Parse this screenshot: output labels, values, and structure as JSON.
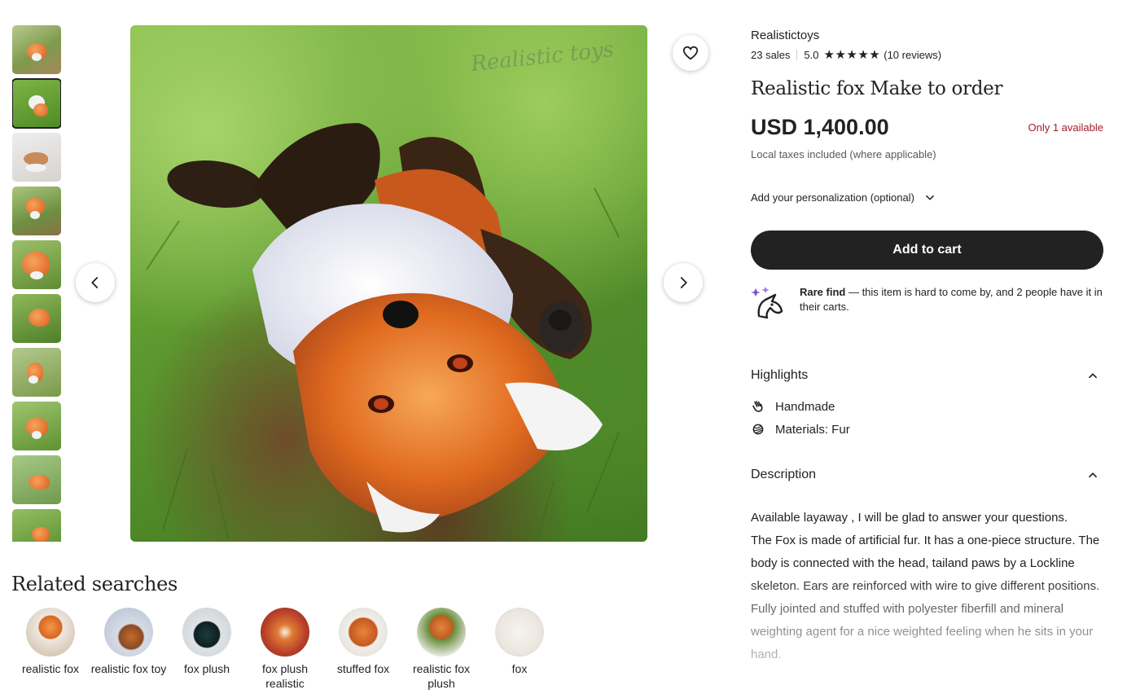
{
  "gallery": {
    "watermark": "Realistic toys",
    "thumbnails": [
      {
        "alt": "fox thumbnail 1"
      },
      {
        "alt": "fox thumbnail 2"
      },
      {
        "alt": "fox thumbnail 3"
      },
      {
        "alt": "fox thumbnail 4"
      },
      {
        "alt": "fox thumbnail 5"
      },
      {
        "alt": "fox thumbnail 6"
      },
      {
        "alt": "fox thumbnail 7"
      },
      {
        "alt": "fox thumbnail 8"
      },
      {
        "alt": "fox thumbnail 9"
      },
      {
        "alt": "fox thumbnail 10"
      }
    ],
    "active_thumbnail": 2
  },
  "related": {
    "title": "Related searches",
    "items": [
      {
        "label": "realistic fox"
      },
      {
        "label": "realistic fox toy"
      },
      {
        "label": "fox plush"
      },
      {
        "label": "fox plush realistic"
      },
      {
        "label": "stuffed fox"
      },
      {
        "label": "realistic fox plush"
      },
      {
        "label": "fox"
      }
    ]
  },
  "product": {
    "shop_name": "Realistictoys",
    "sales": "23 sales",
    "rating": "5.0",
    "stars": "★★★★★",
    "reviews": "(10 reviews)",
    "title": "Realistic fox Make to order",
    "price": "USD 1,400.00",
    "availability": "Only 1 available",
    "tax_note": "Local taxes included (where applicable)",
    "personalization_label": "Add your personalization (optional)",
    "add_to_cart": "Add to cart",
    "rare_find_bold": "Rare find",
    "rare_find_text": " — this item is hard to come by, and 2 people have it in their carts."
  },
  "highlights": {
    "title": "Highlights",
    "items": [
      {
        "icon": "hand-icon",
        "label": "Handmade"
      },
      {
        "icon": "yarn-icon",
        "label": "Materials: Fur"
      }
    ]
  },
  "description": {
    "title": "Description",
    "line1": "Available layaway , I will be glad to answer your questions.",
    "line2": "The Fox is made of artificial fur. It has a one-piece structure. The body is connected with the head, tailand paws by a Lockline skeleton. Ears are reinforced with wire to give different positions. Fully jointed and stuffed with polyester fiberfill and mineral weighting agent for a nice weighted feeling when he sits in your hand."
  },
  "colors": {
    "primary_button": "#222222",
    "availability": "#a61a2e",
    "muted_text": "#595959"
  }
}
